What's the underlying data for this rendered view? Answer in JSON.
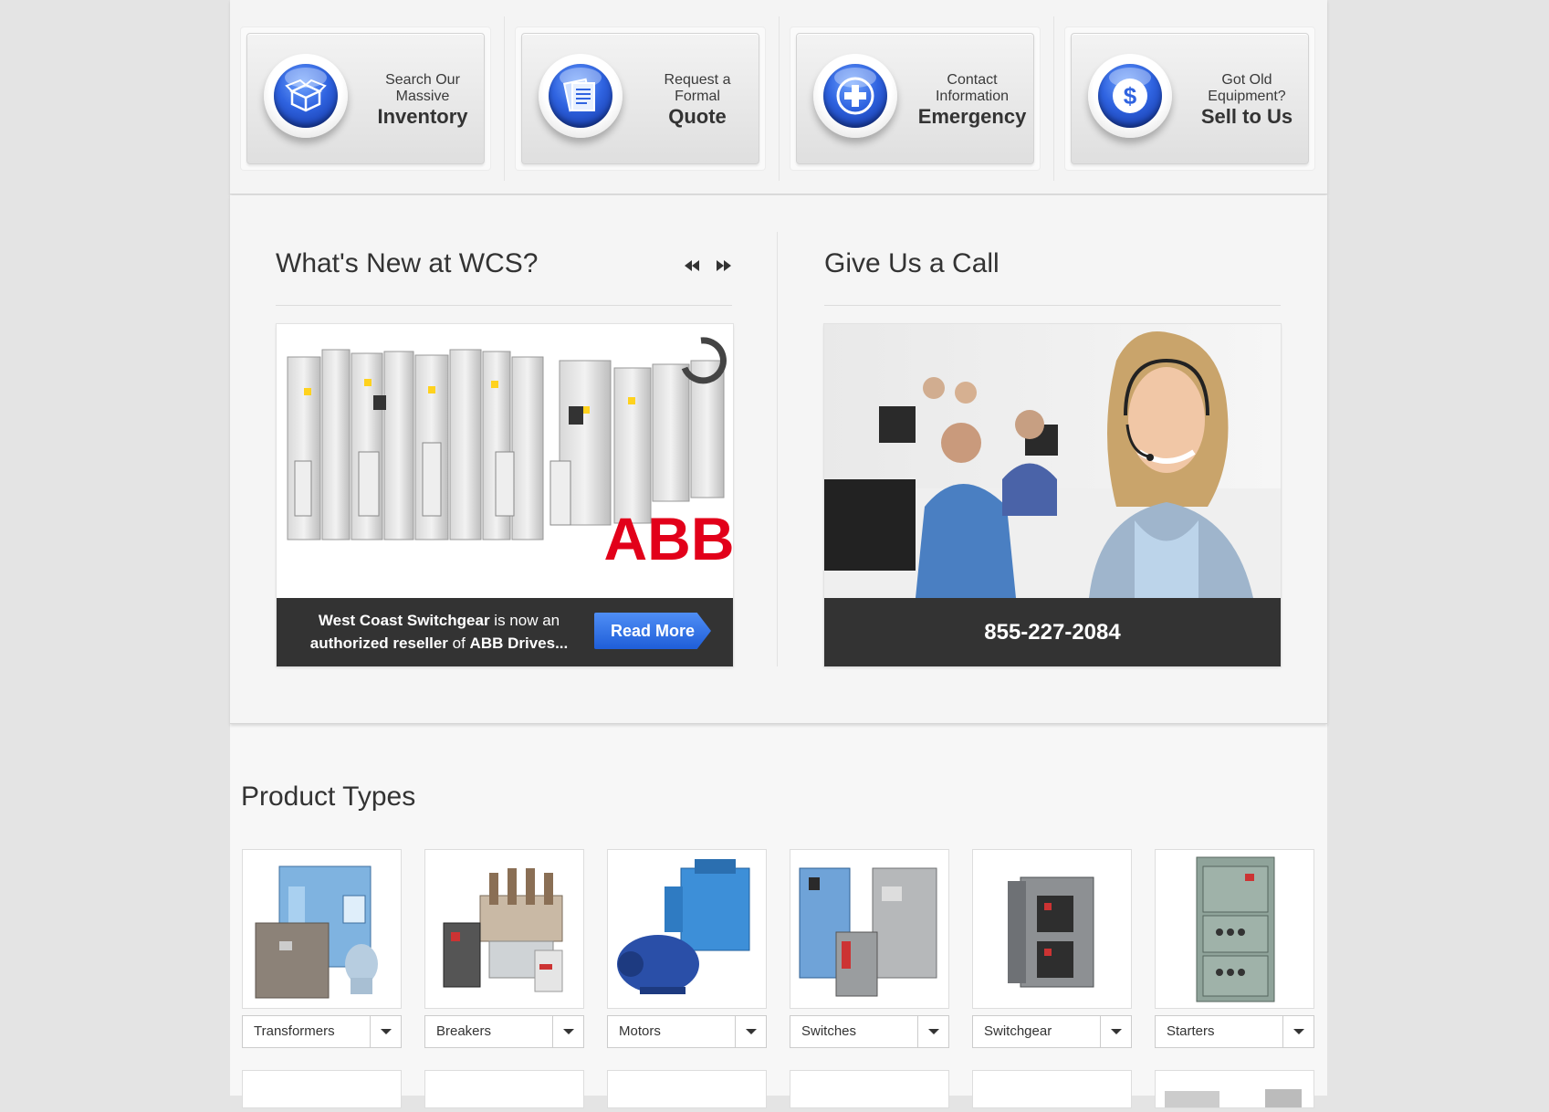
{
  "cards": [
    {
      "line1": "Search Our",
      "line2": "Massive",
      "title": "Inventory",
      "icon": "box-icon"
    },
    {
      "line1": "Request a",
      "line2": "Formal",
      "title": "Quote",
      "icon": "document-icon"
    },
    {
      "line1": "Contact",
      "line2": "Information",
      "title": "Emergency",
      "icon": "plus-icon"
    },
    {
      "line1": "Got Old",
      "line2": "Equipment?",
      "title": "Sell to Us",
      "icon": "dollar-icon"
    }
  ],
  "news": {
    "title": "What's New at WCS?",
    "brand": "ABB",
    "text_bold1": "West Coast Switchgear",
    "text_plain1": " is now an ",
    "text_bold2": "authorized reseller",
    "text_plain2": " of ",
    "text_bold3": "ABB Drives...",
    "read_more": "Read More"
  },
  "call": {
    "title": "Give Us a Call",
    "phone": "855-227-2084"
  },
  "products": {
    "title": "Product Types",
    "items": [
      {
        "label": "Transformers"
      },
      {
        "label": "Breakers"
      },
      {
        "label": "Motors"
      },
      {
        "label": "Switches"
      },
      {
        "label": "Switchgear"
      },
      {
        "label": "Starters"
      }
    ]
  },
  "colors": {
    "accent_blue": "#1f5ed8",
    "dark_bar": "#333333",
    "abb_red": "#e2001a"
  }
}
